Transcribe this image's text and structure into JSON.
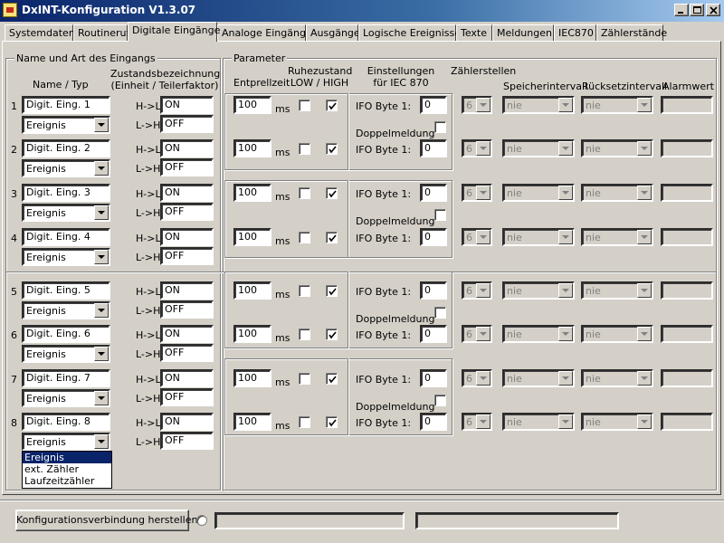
{
  "window": {
    "title": "DxINT-Konfiguration V1.3.07"
  },
  "tabs": [
    {
      "label": "Systemdaten"
    },
    {
      "label": "Routineruf"
    },
    {
      "label": "Digitale Eingänge"
    },
    {
      "label": "Analoge Eingänge"
    },
    {
      "label": "Ausgänge"
    },
    {
      "label": "Logische Ereignisse"
    },
    {
      "label": "Texte"
    },
    {
      "label": "Meldungen"
    },
    {
      "label": "IEC870"
    },
    {
      "label": "Zählerstände"
    }
  ],
  "inputs_group": {
    "title": "Name und Art des Eingangs",
    "col_name": "Name / Typ",
    "col_state_1": "Zustandsbezeichnung",
    "col_state_2": "(Einheit / Teilerfaktor)",
    "hl_label": "H->L",
    "lh_label": "L->H"
  },
  "params_group": {
    "title": "Parameter",
    "col_debounce": "Entprellzeit",
    "col_rest_1": "Ruhezustand",
    "col_rest_2": "LOW / HIGH",
    "col_iec_1": "Einstellungen",
    "col_iec_2": "für IEC 870",
    "col_counter": "Zählerstellen",
    "col_store": "Speicherintervall",
    "col_reset": "Rücksetzintervall",
    "col_alarm": "Alarmwert",
    "ms_unit": "ms",
    "ifo_label": "IFO Byte 1:",
    "double_label": "Doppelmeldung"
  },
  "rows": [
    {
      "num": "1",
      "name": "Digit. Eing. 1",
      "type": "Ereignis",
      "hl": "ON",
      "lh": "OFF",
      "debounce": "100",
      "low": false,
      "high": true,
      "ifo": "0",
      "counter": "6",
      "store": "nie",
      "reset": "nie",
      "alarm": ""
    },
    {
      "num": "2",
      "name": "Digit. Eing. 2",
      "type": "Ereignis",
      "hl": "ON",
      "lh": "OFF",
      "debounce": "100",
      "low": false,
      "high": true,
      "ifo": "0",
      "counter": "6",
      "store": "nie",
      "reset": "nie",
      "alarm": ""
    },
    {
      "num": "3",
      "name": "Digit. Eing. 3",
      "type": "Ereignis",
      "hl": "ON",
      "lh": "OFF",
      "debounce": "100",
      "low": false,
      "high": true,
      "ifo": "0",
      "counter": "6",
      "store": "nie",
      "reset": "nie",
      "alarm": ""
    },
    {
      "num": "4",
      "name": "Digit. Eing. 4",
      "type": "Ereignis",
      "hl": "ON",
      "lh": "OFF",
      "debounce": "100",
      "low": false,
      "high": true,
      "ifo": "0",
      "counter": "6",
      "store": "nie",
      "reset": "nie",
      "alarm": ""
    },
    {
      "num": "5",
      "name": "Digit. Eing. 5",
      "type": "Ereignis",
      "hl": "ON",
      "lh": "OFF",
      "debounce": "100",
      "low": false,
      "high": true,
      "ifo": "0",
      "counter": "6",
      "store": "nie",
      "reset": "nie",
      "alarm": ""
    },
    {
      "num": "6",
      "name": "Digit. Eing. 6",
      "type": "Ereignis",
      "hl": "ON",
      "lh": "OFF",
      "debounce": "100",
      "low": false,
      "high": true,
      "ifo": "0",
      "counter": "6",
      "store": "nie",
      "reset": "nie",
      "alarm": ""
    },
    {
      "num": "7",
      "name": "Digit. Eing. 7",
      "type": "Ereignis",
      "hl": "ON",
      "lh": "OFF",
      "debounce": "100",
      "low": false,
      "high": true,
      "ifo": "0",
      "counter": "6",
      "store": "nie",
      "reset": "nie",
      "alarm": ""
    },
    {
      "num": "8",
      "name": "Digit. Eing. 8",
      "type": "Ereignis",
      "hl": "ON",
      "lh": "OFF",
      "debounce": "100",
      "low": false,
      "high": true,
      "ifo": "0",
      "counter": "6",
      "store": "nie",
      "reset": "nie",
      "alarm": ""
    }
  ],
  "pairs": [
    {
      "double": false
    },
    {
      "double": false
    },
    {
      "double": false
    },
    {
      "double": false
    }
  ],
  "type_dropdown": {
    "options": [
      "Ereignis",
      "ext. Zähler",
      "Laufzeitzähler"
    ],
    "selected": "Ereignis"
  },
  "footer": {
    "connect_button": "Konfigurationsverbindung herstellen",
    "status1": "",
    "status2": ""
  }
}
